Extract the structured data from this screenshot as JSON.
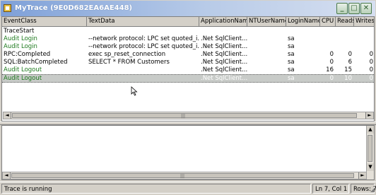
{
  "window": {
    "title": "MyTrace (9E0D682EA6AE448)",
    "minimize_glyph": "_",
    "maximize_glyph": "□",
    "close_glyph": "✕"
  },
  "columns": [
    "EventClass",
    "TextData",
    "ApplicationName",
    "NTUserName",
    "LoginName",
    "CPU",
    "Reads",
    "Writes"
  ],
  "rows": [
    {
      "event": "TraceStart",
      "text": "",
      "app": "",
      "nt": "",
      "login": "",
      "cpu": "",
      "reads": "",
      "writes": "",
      "color": "#000000"
    },
    {
      "event": "Audit Login",
      "text": "--network protocol: LPC set quoted_i...",
      "app": ".Net SqlClient...",
      "nt": "",
      "login": "sa",
      "cpu": "",
      "reads": "",
      "writes": "",
      "color": "#1e7a1e"
    },
    {
      "event": "Audit Login",
      "text": "--network protocol: LPC set quoted_i...",
      "app": ".Net SqlClient...",
      "nt": "",
      "login": "sa",
      "cpu": "",
      "reads": "",
      "writes": "",
      "color": "#1e7a1e"
    },
    {
      "event": "RPC:Completed",
      "text": "exec sp_reset_connection",
      "app": ".Net SqlClient...",
      "nt": "",
      "login": "sa",
      "cpu": "0",
      "reads": "0",
      "writes": "0",
      "color": "#000000"
    },
    {
      "event": "SQL:BatchCompleted",
      "text": "SELECT * FROM Customers",
      "app": ".Net SqlClient...",
      "nt": "",
      "login": "sa",
      "cpu": "0",
      "reads": "6",
      "writes": "0",
      "color": "#000000"
    },
    {
      "event": "Audit Logout",
      "text": "",
      "app": ".Net SqlClient...",
      "nt": "",
      "login": "sa",
      "cpu": "16",
      "reads": "15",
      "writes": "0",
      "color": "#1e7a1e"
    },
    {
      "event": "Audit Logout",
      "text": "",
      "app": ".Net SqlClient...",
      "nt": "",
      "login": "sa",
      "cpu": "0",
      "reads": "10",
      "writes": "0",
      "color": "#1e7a1e",
      "selected": true
    }
  ],
  "text_pane": {
    "content": ""
  },
  "status": {
    "message": "Trace is running",
    "position": "Ln 7, Col 1",
    "rows": "Rows: 7"
  },
  "icons": {
    "grip": "|||",
    "left_arrow": "◄",
    "right_arrow": "►",
    "up_arrow": "▲",
    "down_arrow": "▼",
    "resize": "◢"
  }
}
